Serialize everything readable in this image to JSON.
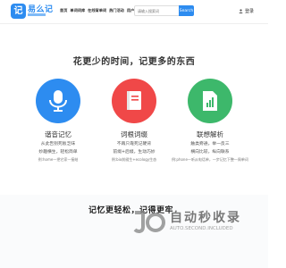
{
  "header": {
    "logo_text": "易么记",
    "logo_mark": "记",
    "nav": [
      "首页",
      "单词词库",
      "在线背单词",
      "热门活动",
      "用户报告"
    ],
    "search_placeholder": "请输入搜索词",
    "search_button": "Search",
    "login": "登录"
  },
  "slogan": "花更少的时间，记更多的东西",
  "features": [
    {
      "title": "谐音记忆",
      "lines": [
        "从此告别死板乏味",
        "妙趣横生，轻松简单"
      ],
      "example": "例:home—把它家—接结",
      "color": "#2d8cf0",
      "icon": "microphone-icon"
    },
    {
      "title": "词根词缀",
      "lines": [
        "不再只靠死记硬背",
        "前缀+后缀，生动巧妙"
      ],
      "example": "例:bio前缀生+ecology生态",
      "color": "#f04848",
      "icon": "book-icon"
    },
    {
      "title": "联想解析",
      "lines": [
        "触类旁通，举一反三",
        "横向比较，纵向联系"
      ],
      "example": "例:phone—听从电话单，一步记忆下整一周单词",
      "color": "#3db86b",
      "icon": "document-chart-icon"
    }
  ],
  "banner": {
    "title": "记忆更轻松，记得更牢",
    "watermark_title": "自动秒收录",
    "watermark_sub": "AUTO.SECOND.INCLUDED"
  }
}
